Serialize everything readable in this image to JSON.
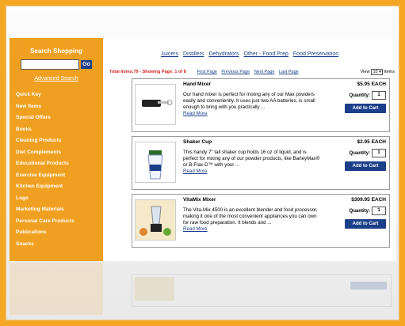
{
  "sidebar": {
    "search_title": "Search Shopping",
    "go_label": "Go",
    "advanced_search": "Advanced Search",
    "categories": [
      "Quick Key",
      "New Items",
      "Special Offers",
      "Books",
      "Cleaning Products",
      "Diet Complements",
      "Educational Products",
      "Exercise Equipment",
      "Kitchen Equipment",
      "Logo",
      "Marketing Materials",
      "Personal Care Products",
      "Publications",
      "Snacks"
    ]
  },
  "topnav": [
    "Juicers",
    "Distillers",
    "Dehydrators",
    "Other - Food Prep",
    "Food Preservation"
  ],
  "status": {
    "total": "Total Items:79 - Showing Page: 1 of 8",
    "pager": [
      "First Page",
      "Previous Page",
      "Next Page",
      "Last Page"
    ],
    "view_label": "View",
    "view_value": "10",
    "items_label": "items"
  },
  "products": [
    {
      "name": "Hand Mixer",
      "price": "$5.95 EACH",
      "qty_label": "Quantity:",
      "qty": "1",
      "add": "Add to Cart",
      "desc": "Our hand mixer is perfect for mixing any of our Max powders easily and conveniently. It uses just two AA batteries, is small enough to bring with you practically ...",
      "more": "Read More"
    },
    {
      "name": "Shaker Cup",
      "price": "$2.95 EACH",
      "qty_label": "Quantity:",
      "qty": "1",
      "add": "Add to Cart",
      "desc": "This handy 7\" tall shaker cup holds 16 oz of liquid, and is perfect for mixing any of our powder products, like BarleyMax® or B-Flax-D™ with your ...",
      "more": "Read More"
    },
    {
      "name": "VitaMix Mixer",
      "price": "$309.95 EACH",
      "qty_label": "Quantity:",
      "qty": "1",
      "add": "Add to Cart",
      "desc": "The Vita-Mix 4500 is an excellent blender and food processor, making it one of the most convenient appliances you can own for raw food preparation. It blends and ...",
      "more": "Read More"
    }
  ]
}
